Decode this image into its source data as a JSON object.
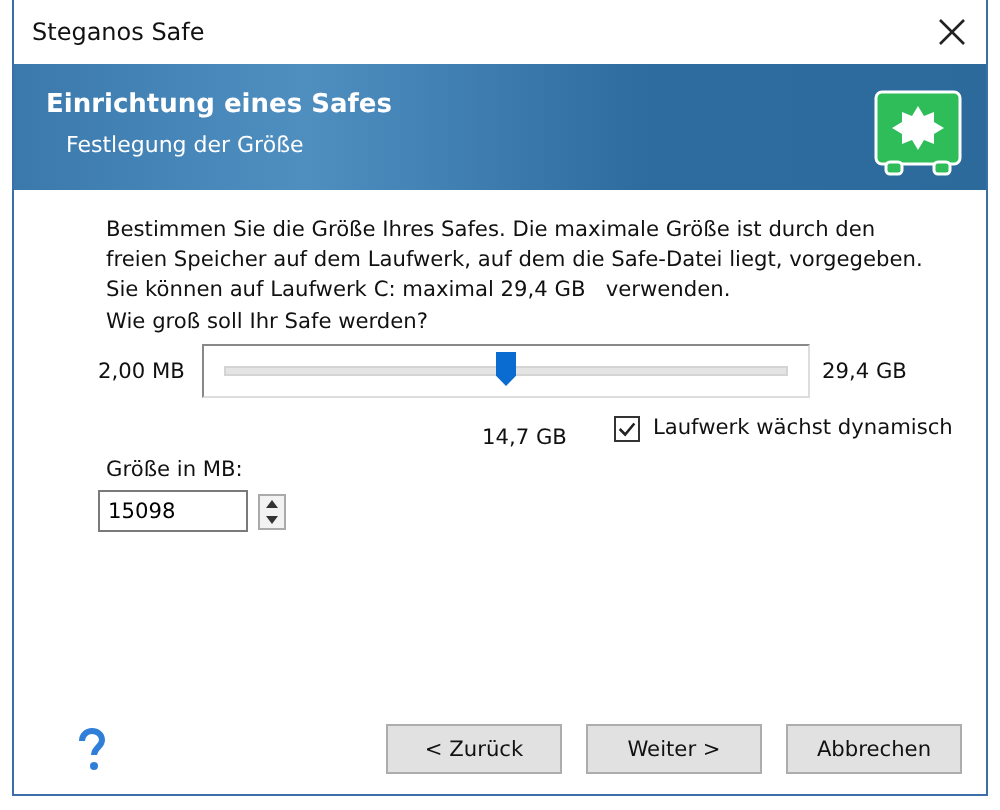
{
  "window": {
    "title": "Steganos Safe"
  },
  "header": {
    "title": "Einrichtung eines Safes",
    "subtitle": "Festlegung der Größe"
  },
  "description": "Bestimmen Sie die Größe Ihres Safes. Die maximale Größe ist durch den freien Speicher auf dem Laufwerk, auf dem die Safe-Datei liegt, vorgegeben.",
  "capacity_note": "Sie können auf Laufwerk C: maximal 29,4 GB   verwenden.",
  "question": "Wie groß soll Ihr Safe werden?",
  "slider": {
    "min_label": "2,00 MB",
    "max_label": "29,4 GB",
    "level": 0.5,
    "reading": "14,7 GB"
  },
  "checkbox": {
    "label": "Laufwerk wächst dynamisch",
    "checked": true
  },
  "size_field": {
    "label": "Größe in MB:",
    "value": "15098"
  },
  "buttons": [
    {
      "label": "< Zurück"
    },
    {
      "label": "Weiter >"
    },
    {
      "label": "Abbrechen"
    }
  ]
}
